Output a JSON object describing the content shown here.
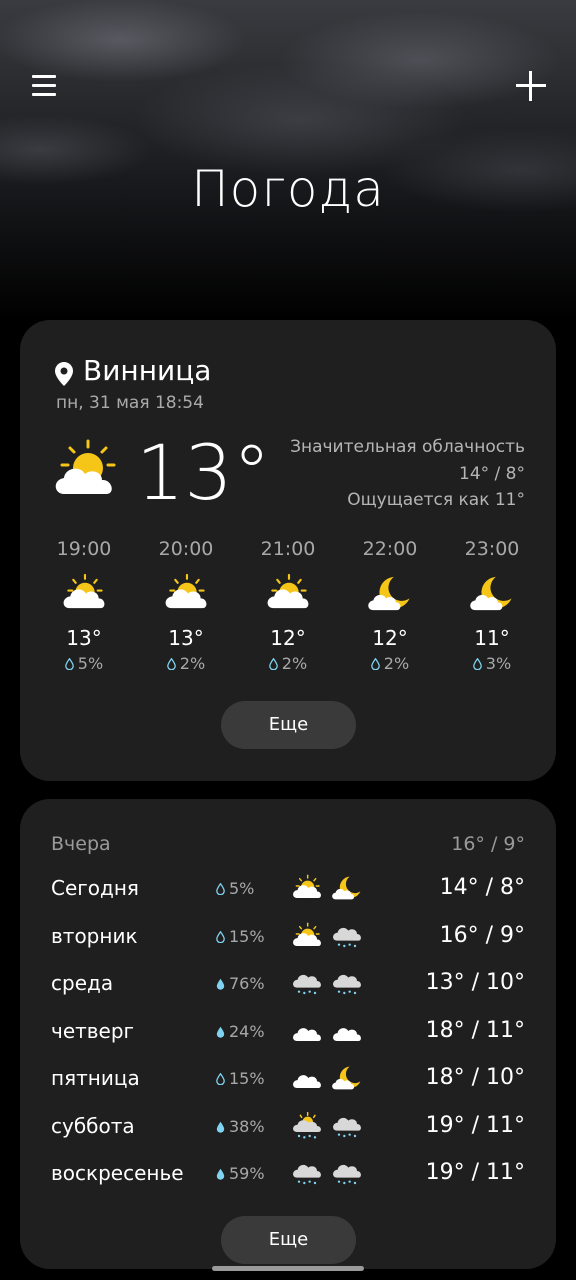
{
  "header": {
    "title": "Погода",
    "menu_icon": "hamburger-menu-icon",
    "add_icon": "plus-icon"
  },
  "current": {
    "city": "Винница",
    "datetime": "пн, 31 мая 18:54",
    "temp": "13°",
    "icon": "partly-cloudy-sun",
    "condition": "Значительная облачность",
    "high_low": "14° / 8°",
    "feels_like": "Ощущается как 11°"
  },
  "hourly": [
    {
      "time": "19:00",
      "temp": "13°",
      "precip": "5%",
      "icon": "partly-cloudy-sun"
    },
    {
      "time": "20:00",
      "temp": "13°",
      "precip": "2%",
      "icon": "partly-cloudy-sun"
    },
    {
      "time": "21:00",
      "temp": "12°",
      "precip": "2%",
      "icon": "partly-cloudy-sun"
    },
    {
      "time": "22:00",
      "temp": "12°",
      "precip": "2%",
      "icon": "partly-cloudy-moon"
    },
    {
      "time": "23:00",
      "temp": "11°",
      "precip": "3%",
      "icon": "partly-cloudy-moon"
    }
  ],
  "hourly_more_label": "Еще",
  "yesterday": {
    "label": "Вчера",
    "high_low": "16° / 9°"
  },
  "daily": [
    {
      "day": "Сегодня",
      "precip": "5%",
      "hl": "14° / 8°",
      "day_icon": "partly-cloudy-sun",
      "night_icon": "partly-cloudy-moon"
    },
    {
      "day": "вторник",
      "precip": "15%",
      "hl": "16° / 9°",
      "day_icon": "partly-cloudy-sun",
      "night_icon": "rain-cloud"
    },
    {
      "day": "среда",
      "precip": "76%",
      "hl": "13° / 10°",
      "day_icon": "rain-cloud",
      "night_icon": "rain-cloud"
    },
    {
      "day": "четверг",
      "precip": "24%",
      "hl": "18° / 11°",
      "day_icon": "cloud",
      "night_icon": "cloud"
    },
    {
      "day": "пятница",
      "precip": "15%",
      "hl": "18° / 10°",
      "day_icon": "cloud",
      "night_icon": "partly-cloudy-moon"
    },
    {
      "day": "суббота",
      "precip": "38%",
      "hl": "19° / 11°",
      "day_icon": "sun-rain-cloud",
      "night_icon": "rain-cloud"
    },
    {
      "day": "воскресенье",
      "precip": "59%",
      "hl": "19° / 11°",
      "day_icon": "rain-cloud",
      "night_icon": "rain-cloud"
    }
  ],
  "daily_more_label": "Еще",
  "colors": {
    "sun": "#f5c518",
    "cloud": "#ffffff",
    "card": "#1f1f1f",
    "drop": "#7fd3f0"
  }
}
